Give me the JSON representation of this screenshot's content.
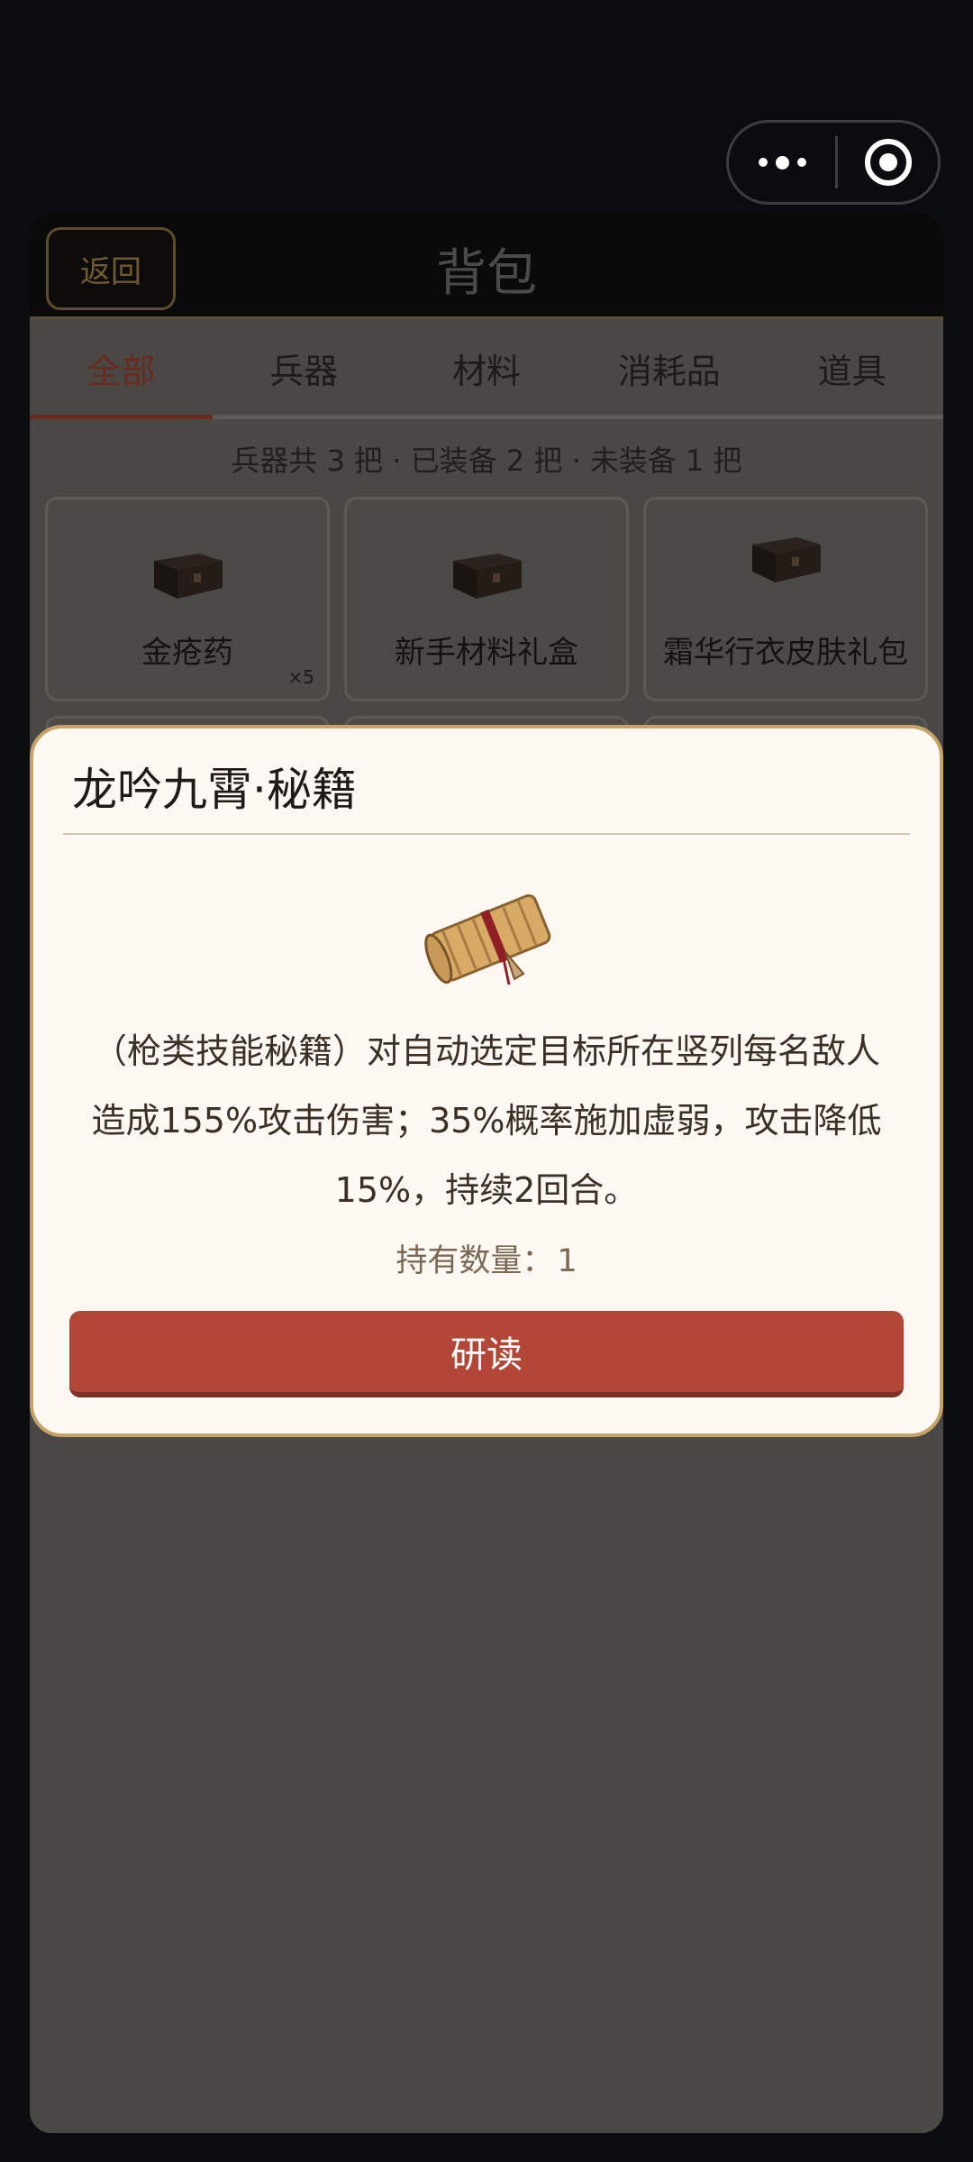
{
  "capsule": {
    "more_icon": "more-dots-icon",
    "close_icon": "target-circle-icon"
  },
  "header": {
    "back_label": "返回",
    "title": "背包"
  },
  "tabs": [
    {
      "label": "全部",
      "active": true
    },
    {
      "label": "兵器",
      "active": false
    },
    {
      "label": "材料",
      "active": false
    },
    {
      "label": "消耗品",
      "active": false
    },
    {
      "label": "道具",
      "active": false
    }
  ],
  "summary": "兵器共 3 把 · 已装备 2 把 · 未装备 1 把",
  "items": [
    {
      "name": "金疮药",
      "qty": "×5",
      "icon": "chest-icon"
    },
    {
      "name": "新手材料礼盒",
      "qty": "",
      "icon": "chest-icon"
    },
    {
      "name": "霜华行衣皮肤礼包",
      "qty": "",
      "icon": "chest-icon"
    }
  ],
  "modal": {
    "title": "龙吟九霄·秘籍",
    "icon": "scroll-icon",
    "description": "（枪类技能秘籍）对自动选定目标所在竖列每名敌人造成155%攻击伤害；35%概率施加虚弱，攻击降低15%，持续2回合。",
    "holding_label": "持有数量：",
    "holding_value": "1",
    "action_label": "研读"
  },
  "colors": {
    "accent": "#b24637",
    "modal_border": "#c6a366",
    "modal_bg": "#fdf9f2"
  }
}
